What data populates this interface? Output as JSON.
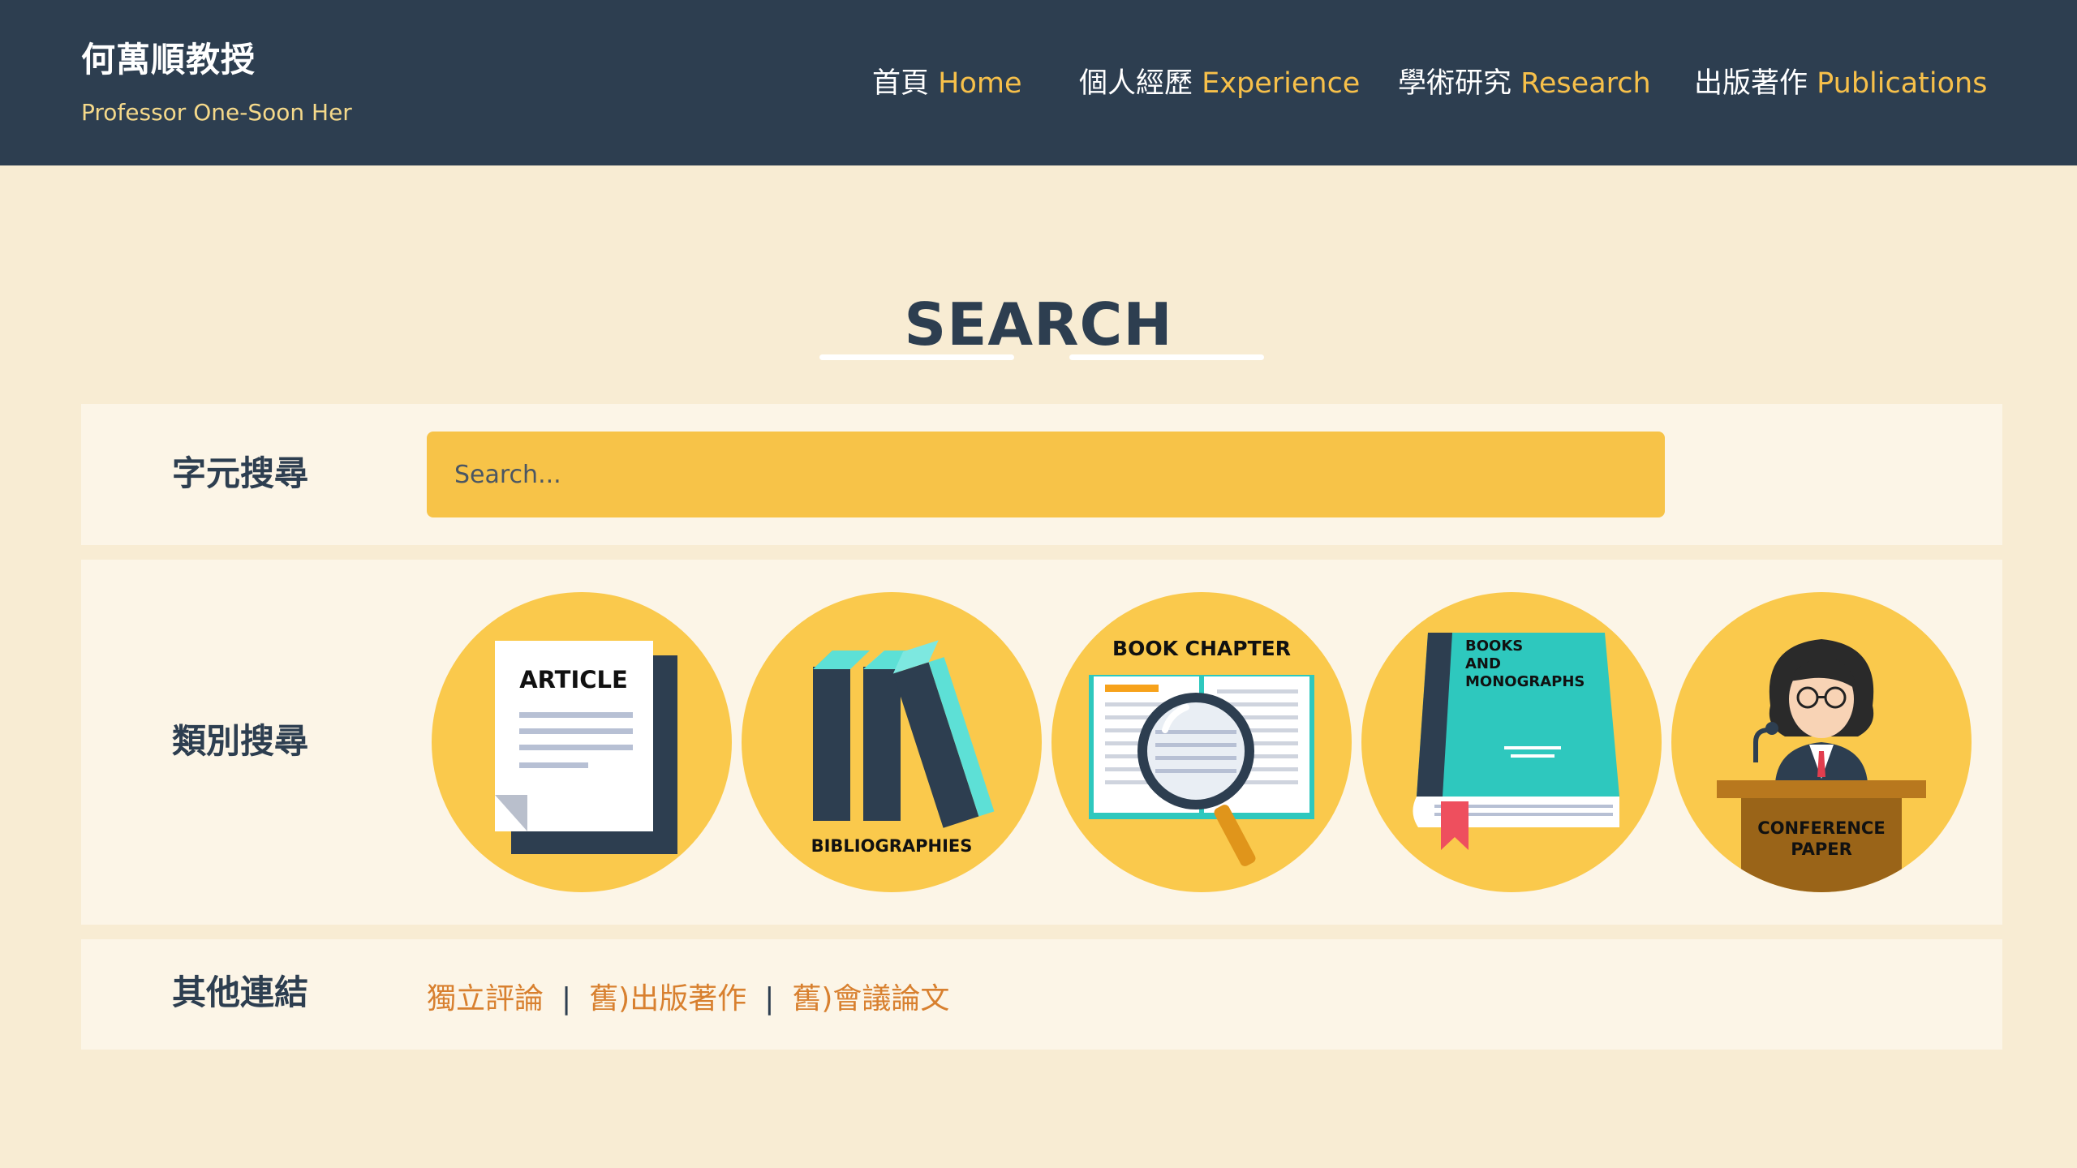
{
  "header": {
    "title": "何萬順教授",
    "subtitle": "Professor One-Soon Her",
    "nav": [
      {
        "zh": "首頁",
        "en": "Home"
      },
      {
        "zh": "個人經歷",
        "en": "Experience"
      },
      {
        "zh": "學術研究",
        "en": "Research"
      },
      {
        "zh": "出版著作",
        "en": "Publications"
      }
    ]
  },
  "page": {
    "title": "SEARCH"
  },
  "text_search": {
    "label": "字元搜尋",
    "placeholder": "Search..."
  },
  "category_search": {
    "label": "類別搜尋",
    "categories": [
      {
        "label": "ARTICLE",
        "icon": "article-icon"
      },
      {
        "label": "BIBLIOGRAPHIES",
        "icon": "bibliographies-icon"
      },
      {
        "label": "BOOK CHAPTER",
        "icon": "book-chapter-icon"
      },
      {
        "label_line1": "BOOKS",
        "label_line2": "AND",
        "label_line3": "MONOGRAPHS",
        "icon": "books-monographs-icon"
      },
      {
        "label_line1": "CONFERENCE",
        "label_line2": "PAPER",
        "icon": "conference-paper-icon"
      }
    ]
  },
  "other_links": {
    "label": "其他連結",
    "links": [
      "獨立評論",
      "舊)出版著作",
      "舊)會議論文"
    ],
    "separator": "|"
  },
  "colors": {
    "header_bg": "#2d3e50",
    "page_bg": "#f8ecd3",
    "accent_yellow": "#f7c348",
    "link_orange": "#d8802f",
    "teal": "#2ec8be"
  }
}
